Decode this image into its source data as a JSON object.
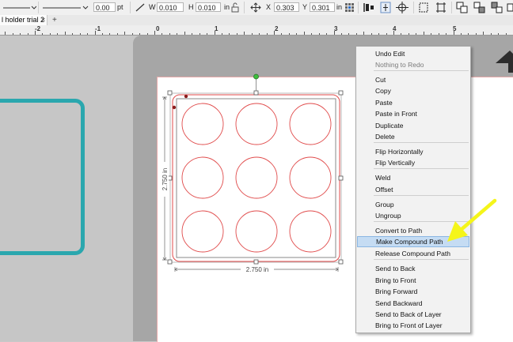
{
  "toolbar": {
    "line_width_value": "0.00",
    "line_width_unit": "pt",
    "w_label": "W",
    "w_value": "0.010",
    "h_label": "H",
    "h_value": "0.010",
    "size_unit": "in",
    "x_label": "X",
    "x_value": "0.303",
    "y_label": "Y",
    "y_value": "0.301",
    "pos_unit": "in"
  },
  "tabs": [
    {
      "label": "l holder trial 2"
    }
  ],
  "tab_close": "×",
  "tab_add": "+",
  "ruler": {
    "labels": [
      "-2",
      "-1",
      "0",
      "1",
      "2",
      "3",
      "4",
      "5"
    ]
  },
  "design": {
    "width_label": "2.750 in",
    "height_label": "2.750 in",
    "circle_color": "#e04a4a",
    "selection_color": "#888888",
    "accent_teal": "#2aa7ae"
  },
  "context_menu": {
    "items": [
      {
        "label": "Undo Edit",
        "enabled": true
      },
      {
        "label": "Nothing to Redo",
        "enabled": false
      },
      {
        "label": "Cut",
        "enabled": true
      },
      {
        "label": "Copy",
        "enabled": true
      },
      {
        "label": "Paste",
        "enabled": true
      },
      {
        "label": "Paste in Front",
        "enabled": true
      },
      {
        "label": "Duplicate",
        "enabled": true
      },
      {
        "label": "Delete",
        "enabled": true
      },
      {
        "label": "Flip Horizontally",
        "enabled": true
      },
      {
        "label": "Flip Vertically",
        "enabled": true
      },
      {
        "label": "Weld",
        "enabled": true
      },
      {
        "label": "Offset",
        "enabled": true
      },
      {
        "label": "Group",
        "enabled": true
      },
      {
        "label": "Ungroup",
        "enabled": true
      },
      {
        "label": "Convert to Path",
        "enabled": true
      },
      {
        "label": "Make Compound Path",
        "enabled": true,
        "highlighted": true
      },
      {
        "label": "Release Compound Path",
        "enabled": true
      },
      {
        "label": "Send to Back",
        "enabled": true
      },
      {
        "label": "Bring to Front",
        "enabled": true
      },
      {
        "label": "Bring Forward",
        "enabled": true
      },
      {
        "label": "Send Backward",
        "enabled": true
      },
      {
        "label": "Send to Back of Layer",
        "enabled": true
      },
      {
        "label": "Bring to Front of Layer",
        "enabled": true
      }
    ]
  },
  "annotation": {
    "arrow_color": "#f5f51a"
  }
}
